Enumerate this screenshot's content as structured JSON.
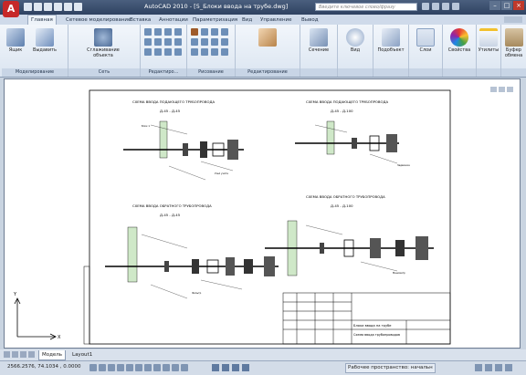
{
  "app": {
    "title": "AutoCAD 2010 - [5_Блоки ввода на трубе.dwg]",
    "logo_letter": "A"
  },
  "search": {
    "placeholder": "Введите ключевое слово/фразу"
  },
  "ribbon_tabs": [
    "Главная",
    "Сетевое моделирование",
    "Вставка",
    "Аннотации",
    "Параметризация",
    "Вид",
    "Управление",
    "Вывод"
  ],
  "panels": {
    "modeling": {
      "label": "Моделирование",
      "buttons": [
        "Ящик",
        "Выдавить"
      ]
    },
    "mesh": {
      "label": "Сеть",
      "buttons": [
        "Сглаживание объекта"
      ]
    },
    "solid_edit": {
      "label": "Редактиро..."
    },
    "draw": {
      "label": "Рисование"
    },
    "modify": {
      "label": "Редактирование"
    },
    "section": {
      "label": "Сечение"
    },
    "view": {
      "label": "Вид"
    },
    "subobject": {
      "label": "Подобъект"
    },
    "layers": {
      "label": "Слои"
    },
    "properties": {
      "label": "Свойства"
    },
    "utilities": {
      "label": "Утилиты"
    },
    "clipboard": {
      "label": "Буфер обмена"
    }
  },
  "drawing": {
    "title_1": "СХЕМА ВВОДА ПОДАЮЩЕГО ТРУБОПРОВОДА",
    "title_1_sub": "Д-45 - Д-45",
    "title_2": "СХЕМА ВВОДА ПОДАЮЩЕГО ТРУБОПРОВОДА",
    "title_2_sub": "Д-45 - Д-100",
    "title_3": "СХЕМА ВВОДА ОБРАТНОГО ТРУБОПРОВОДА",
    "title_3_sub": "Д-45 - Д-45",
    "title_4": "СХЕМА ВВОДА ОБРАТНОГО ТРУБОПРОВОДА",
    "title_4_sub": "Д-45 - Д-100",
    "stamp_title": "Блоки ввода на трубе",
    "stamp_subtitle": "Схема ввода трубопроводов"
  },
  "layout_tabs": [
    "Модель",
    "Layout1"
  ],
  "status": {
    "coords": "2566.2576, 74.1034 , 0.0000",
    "workspace": "Рабочее пространство: начальн"
  }
}
